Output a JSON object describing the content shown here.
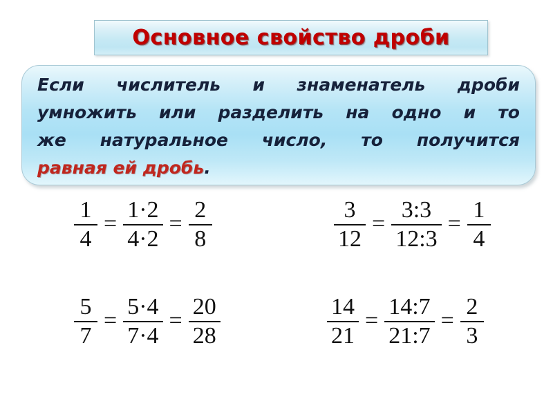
{
  "slide": {
    "title": "Основное свойство дроби",
    "title_color": "#C00000",
    "accent_red": "#C0271E",
    "text_color": "#16213A",
    "box_border_color": "#A8C9D6"
  },
  "statement": {
    "lines": [
      {
        "id": "line1",
        "words": [
          "Если",
          "числитель",
          "и",
          "знаменатель",
          "дроби"
        ]
      },
      {
        "id": "line2",
        "words": [
          "умножить",
          "или",
          "разделить",
          "на",
          "одно",
          "и",
          "то"
        ]
      },
      {
        "id": "line3",
        "words": [
          "же",
          "натуральное",
          "число,",
          "то",
          "получится"
        ]
      }
    ],
    "line4_highlight": "равная ей дробь",
    "line4_period": "."
  },
  "equations": [
    {
      "id": "equation-1-4",
      "left": {
        "num": "1",
        "den": "4"
      },
      "middle": {
        "num": "1·2",
        "den": "4·2"
      },
      "right": {
        "num": "2",
        "den": "8"
      },
      "eq1": "=",
      "eq2": "=",
      "operation": "multiply-by-2"
    },
    {
      "id": "equation-3-12",
      "left": {
        "num": "3",
        "den": "12"
      },
      "middle": {
        "num": "3:3",
        "den": "12:3"
      },
      "right": {
        "num": "1",
        "den": "4"
      },
      "eq1": "=",
      "eq2": "=",
      "operation": "divide-by-3"
    },
    {
      "id": "equation-5-7",
      "left": {
        "num": "5",
        "den": "7"
      },
      "middle": {
        "num": "5·4",
        "den": "7·4"
      },
      "right": {
        "num": "20",
        "den": "28"
      },
      "eq1": "=",
      "eq2": "=",
      "operation": "multiply-by-4"
    },
    {
      "id": "equation-14-21",
      "left": {
        "num": "14",
        "den": "21"
      },
      "middle": {
        "num": "14:7",
        "den": "21:7"
      },
      "right": {
        "num": "2",
        "den": "3"
      },
      "eq1": "=",
      "eq2": "=",
      "operation": "divide-by-7"
    }
  ]
}
